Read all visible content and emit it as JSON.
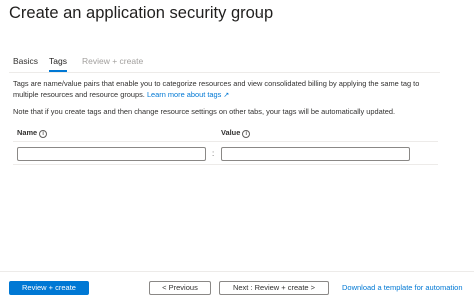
{
  "header": {
    "title": "Create an application security group",
    "more_icon": "···"
  },
  "tabs": [
    {
      "label": "Basics",
      "state": "normal"
    },
    {
      "label": "Tags",
      "state": "active"
    },
    {
      "label": "Review + create",
      "state": "disabled"
    }
  ],
  "description": {
    "text": "Tags are name/value pairs that enable you to categorize resources and view consolidated billing by applying the same tag to multiple resources and resource groups.",
    "link_label": "Learn more about tags",
    "link_icon": "external-link-icon",
    "note": "Note that if you create tags and then change resource settings on other tabs, your tags will be automatically updated."
  },
  "table": {
    "name_header": "Name",
    "value_header": "Value",
    "info_glyph": "i",
    "separator": ":",
    "rows": [
      {
        "name": "",
        "value": ""
      }
    ]
  },
  "footer": {
    "primary_label": "Review + create",
    "previous_label": "< Previous",
    "next_label": "Next : Review + create >",
    "download_label": "Download a template for automation"
  },
  "colors": {
    "accent": "#0078d4",
    "disabled_text": "#a19f9d"
  }
}
